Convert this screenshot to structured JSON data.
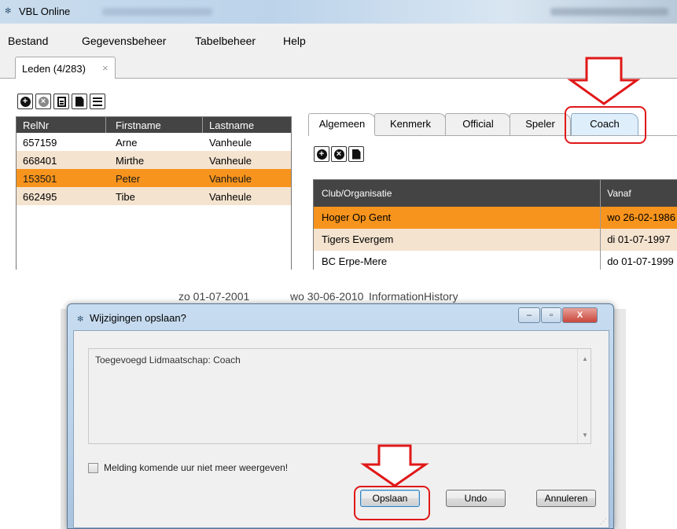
{
  "window": {
    "title": "VBL Online"
  },
  "menu": [
    "Bestand",
    "Gegevensbeheer",
    "Tabelbeheer",
    "Help"
  ],
  "doc_tab": {
    "label": "Leden (4/283)",
    "close": "×"
  },
  "members": {
    "columns": [
      "RelNr",
      "Firstname",
      "Lastname"
    ],
    "rows": [
      {
        "relnr": "657159",
        "firstname": "Arne",
        "lastname": "Vanheule"
      },
      {
        "relnr": "668401",
        "firstname": "Mirthe",
        "lastname": "Vanheule"
      },
      {
        "relnr": "153501",
        "firstname": "Peter",
        "lastname": "Vanheule"
      },
      {
        "relnr": "662495",
        "firstname": "Tibe",
        "lastname": "Vanheule"
      }
    ],
    "selected_index": 2
  },
  "detail_tabs": [
    "Algemeen",
    "Kenmerk",
    "Official",
    "Speler",
    "Coach"
  ],
  "clubs": {
    "columns": [
      "Club/Organisatie",
      "Vanaf"
    ],
    "rows": [
      {
        "club": "Hoger Op Gent",
        "vanaf": "wo 26-02-1986"
      },
      {
        "club": "Tigers Evergem",
        "vanaf": "di 01-07-1997"
      },
      {
        "club": "BC Erpe-Mere",
        "vanaf": "do 01-07-1999"
      }
    ]
  },
  "background_row": {
    "from": "zo 01-07-2001",
    "to": "wo 30-06-2010",
    "type": "InformationHistory"
  },
  "dialog": {
    "title": "Wijzigingen opslaan?",
    "message": "Toegevoegd Lidmaatschap: Coach",
    "checkbox_label": "Melding komende uur niet meer weergeven!",
    "buttons": {
      "save": "Opslaan",
      "undo": "Undo",
      "cancel": "Annuleren"
    },
    "window_buttons": {
      "minimize": "–",
      "maximize": "▫",
      "close": "X"
    }
  },
  "colors": {
    "selected_row": "#f7941d",
    "alt_row": "#f4e3cf",
    "annotation_red": "#e01818",
    "header": "#444444"
  }
}
